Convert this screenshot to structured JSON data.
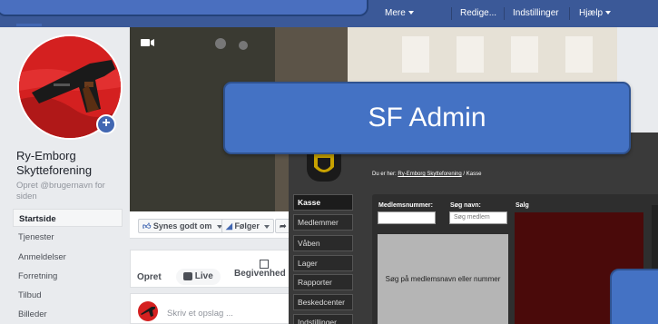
{
  "topbar": {
    "nav": [
      {
        "label": "Mere",
        "dropdown": true
      },
      {
        "label": "Redige...",
        "dropdown": false
      },
      {
        "label": "Indstillinger",
        "dropdown": false
      },
      {
        "label": "Hjælp",
        "dropdown": true
      }
    ]
  },
  "page": {
    "name": "Ry-Emborg Skytteforening",
    "handle": "Opret @brugernavn for siden"
  },
  "left_nav": [
    {
      "label": "Startside",
      "active": true
    },
    {
      "label": "Tjenester",
      "active": false
    },
    {
      "label": "Anmeldelser",
      "active": false
    },
    {
      "label": "Forretning",
      "active": false
    },
    {
      "label": "Tilbud",
      "active": false
    },
    {
      "label": "Billeder",
      "active": false
    }
  ],
  "actions": {
    "like": "Synes godt om",
    "follow": "Følger"
  },
  "create": {
    "label": "Opret",
    "live": "Live",
    "event": "Begivenhed"
  },
  "composer": {
    "placeholder": "Skriv et opslag ..."
  },
  "admin": {
    "breadcrumb_prefix": "Du er her:",
    "breadcrumb_link": "Ry-Emborg Skytteforening",
    "breadcrumb_current": "/ Kasse",
    "menu": [
      "Kasse",
      "Medlemmer",
      "Våben",
      "Lager",
      "Rapporter",
      "Beskedcenter",
      "Indstillinger"
    ],
    "member_label": "Medlemsnummer:",
    "search_label": "Søg navn:",
    "search_placeholder": "Søg medlem",
    "salg_label": "Salg",
    "search_hint": "Søg på medlemsnavn eller nummer"
  },
  "overlay": {
    "title": "SF Admin"
  },
  "colors": {
    "facebook_blue": "#3b5998",
    "overlay_blue": "#4472c4",
    "admin_dark": "#3a3a3a"
  }
}
